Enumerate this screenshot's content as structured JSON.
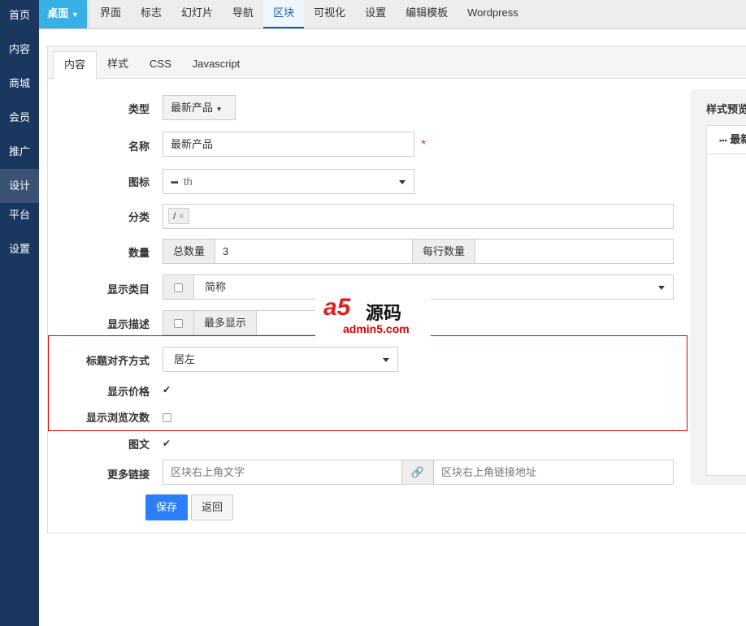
{
  "sidebar": {
    "items": [
      "首页",
      "内容",
      "商城",
      "会员",
      "推广",
      "设计",
      "平台",
      "设置"
    ],
    "active": "设计"
  },
  "topnav": {
    "home": "桌面",
    "items": [
      "界面",
      "标志",
      "幻灯片",
      "导航",
      "区块",
      "可视化",
      "设置",
      "编辑模板",
      "Wordpress"
    ],
    "active": "区块"
  },
  "tabs": [
    "内容",
    "样式",
    "CSS",
    "Javascript"
  ],
  "form": {
    "type_label": "类型",
    "type_value": "最新产品",
    "name_label": "名称",
    "name_value": "最新产品",
    "required": "*",
    "icon_label": "图标",
    "icon_value": "th",
    "category_label": "分类",
    "category_tag": "/",
    "category_tag_remove": "×",
    "count_label": "数量",
    "total_addon": "总数量",
    "total_value": "3",
    "per_row_addon": "每行数量",
    "per_row_value": "",
    "show_category_label": "显示类目",
    "show_category_value": "简称",
    "show_desc_label": "显示描述",
    "show_desc_addon": "最多显示",
    "align_label": "标题对齐方式",
    "align_value": "居左",
    "show_price_label": "显示价格",
    "show_price_checked": true,
    "show_views_label": "显示浏览次数",
    "show_views_checked": false,
    "image_text_label": "图文",
    "image_text_checked": true,
    "more_link_label": "更多链接",
    "more_text_placeholder": "区块右上角文字",
    "more_url_placeholder": "区块右上角链接地址",
    "save": "保存",
    "back": "返回"
  },
  "preview": {
    "title": "样式预览",
    "block_title": "最新产品"
  },
  "watermark": {
    "logo": "a5源码",
    "url": "admin5.com"
  },
  "colors": {
    "sidebar": "#1a3760",
    "accent": "#37b0e6",
    "primary": "#2d7ff9",
    "required": "#e33"
  }
}
